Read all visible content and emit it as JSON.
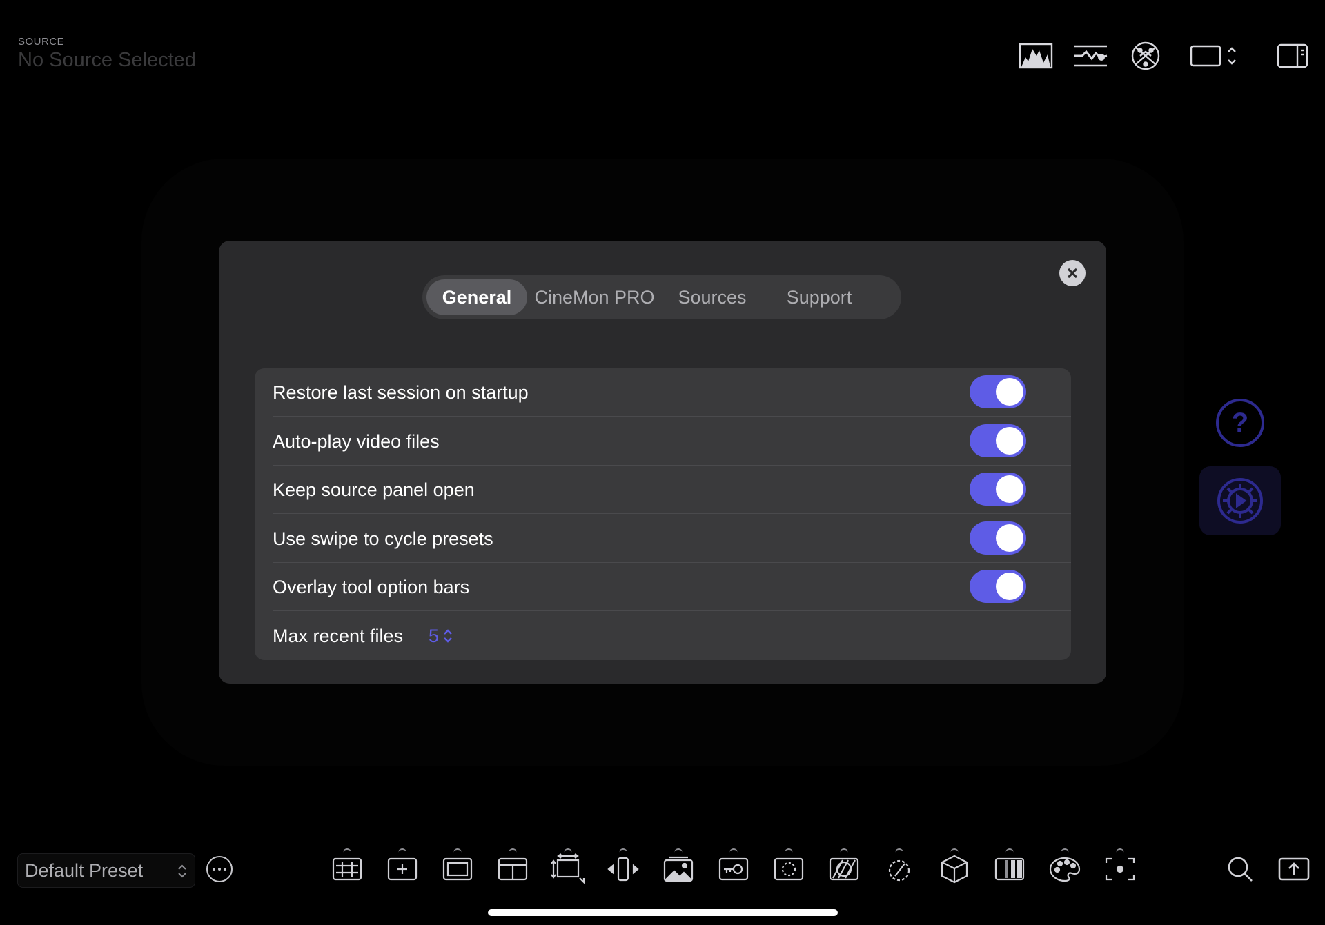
{
  "header": {
    "source_caption": "SOURCE",
    "source_name": "No Source Selected",
    "icons": [
      "histogram-icon",
      "waveform-icon",
      "vectorscope-icon",
      "aspect-ratio-icon",
      "sidebar-icon"
    ]
  },
  "modal": {
    "tabs": [
      {
        "label": "General",
        "active": true
      },
      {
        "label": "CineMon PRO",
        "active": false
      },
      {
        "label": "Sources",
        "active": false
      },
      {
        "label": "Support",
        "active": false
      }
    ],
    "settings": [
      {
        "label": "Restore last session on startup",
        "enabled": true
      },
      {
        "label": "Auto-play video files",
        "enabled": true
      },
      {
        "label": "Keep source panel open",
        "enabled": true
      },
      {
        "label": "Use swipe to cycle presets",
        "enabled": true
      },
      {
        "label": "Overlay tool option bars",
        "enabled": true
      }
    ],
    "max_recent": {
      "label": "Max recent files",
      "value": "5"
    }
  },
  "side_buttons": {
    "help_glyph": "?",
    "icons": [
      "help-icon",
      "settings-icon"
    ]
  },
  "bottom_bar": {
    "preset_label": "Default Preset",
    "tools": [
      "grid-icon",
      "center-marker-icon",
      "frame-guide-icon",
      "safe-area-icon",
      "transform-icon",
      "flip-icon",
      "image-overlay-icon",
      "false-color-icon",
      "focus-peaking-icon",
      "zebra-icon",
      "exposure-icon",
      "lut-cube-icon",
      "gradient-icon",
      "color-palette-icon",
      "spot-meter-icon"
    ]
  },
  "colors": {
    "accent": "#5e5ce6",
    "help_accent": "#2d2a8f",
    "modal_bg": "#2a2a2c",
    "list_bg": "#3a3a3c"
  }
}
